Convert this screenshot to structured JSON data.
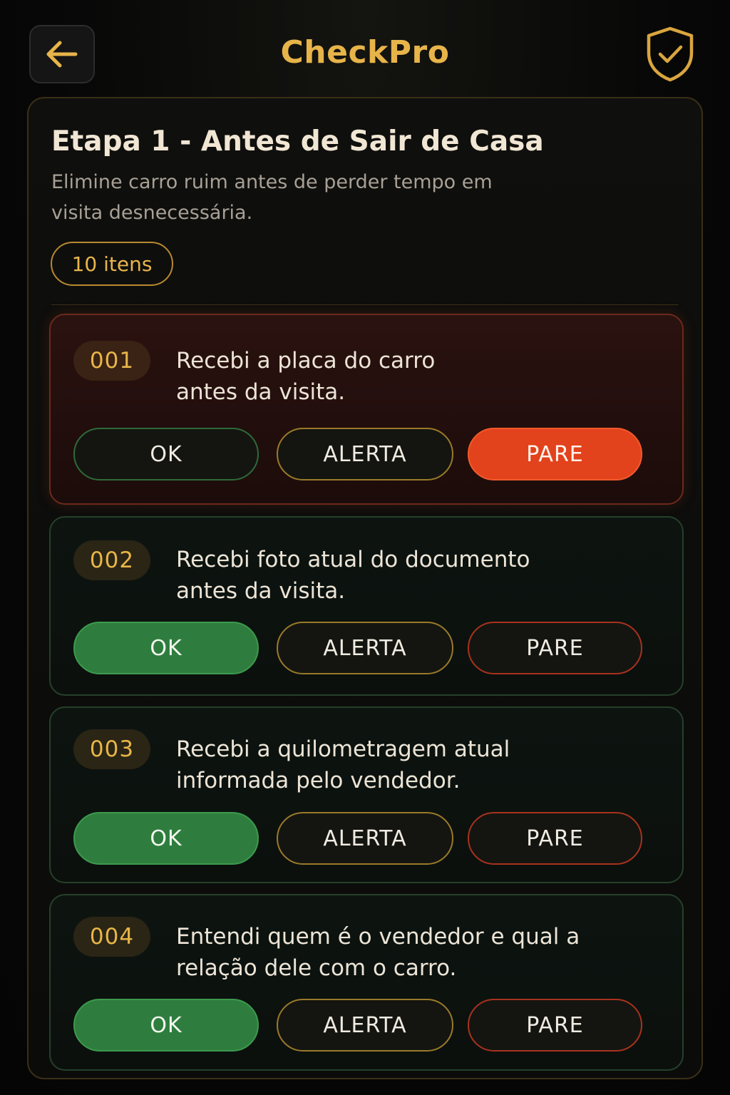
{
  "header": {
    "app_title": "CheckPro",
    "back_icon": "arrow-left-icon",
    "shield_icon": "shield-check-icon"
  },
  "stage": {
    "title": "Etapa 1 - Antes de Sair de Casa",
    "subtitle": "Elimine carro ruim antes de perder tempo em visita desnecessária.",
    "count_label": "10 itens"
  },
  "items": [
    {
      "number": "001",
      "text": "Recebi a placa do carro antes da visita.",
      "ok": "OK",
      "alert": "ALERTA",
      "stop": "PARE",
      "selected": "PARE"
    },
    {
      "number": "002",
      "text": "Recebi foto atual do documento antes da visita.",
      "ok": "OK",
      "alert": "ALERTA",
      "stop": "PARE",
      "selected": "OK"
    },
    {
      "number": "003",
      "text": "Recebi a quilometragem atual informada pelo vendedor.",
      "ok": "OK",
      "alert": "ALERTA",
      "stop": "PARE",
      "selected": "OK"
    },
    {
      "number": "004",
      "text": "Entendi quem é o vendedor e qual a relação dele com o carro.",
      "ok": "OK",
      "alert": "ALERTA",
      "stop": "PARE",
      "selected": "OK"
    }
  ],
  "colors": {
    "accent": "#e7b44a",
    "ok_selected": "#2e7d3e",
    "stop_selected": "#e2421c",
    "alert_border": "#9a7a2a"
  }
}
